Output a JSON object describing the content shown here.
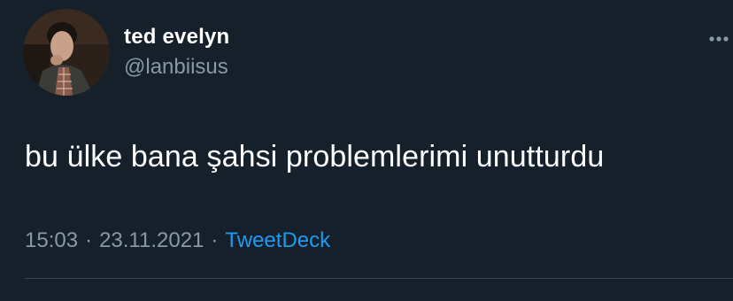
{
  "user": {
    "display_name": "ted evelyn",
    "handle": "@lanbiisus"
  },
  "tweet": {
    "text": "bu ülke bana şahsi problemlerimi unutturdu",
    "time": "15:03",
    "separator": "·",
    "date": "23.11.2021",
    "source": "TweetDeck"
  },
  "icons": {
    "more": "more-dots-icon",
    "avatar": "profile-photo"
  },
  "colors": {
    "background": "#15202b",
    "text_primary": "#ffffff",
    "text_secondary": "#8899a6",
    "accent": "#1d9bf0",
    "divider": "#38444d"
  }
}
